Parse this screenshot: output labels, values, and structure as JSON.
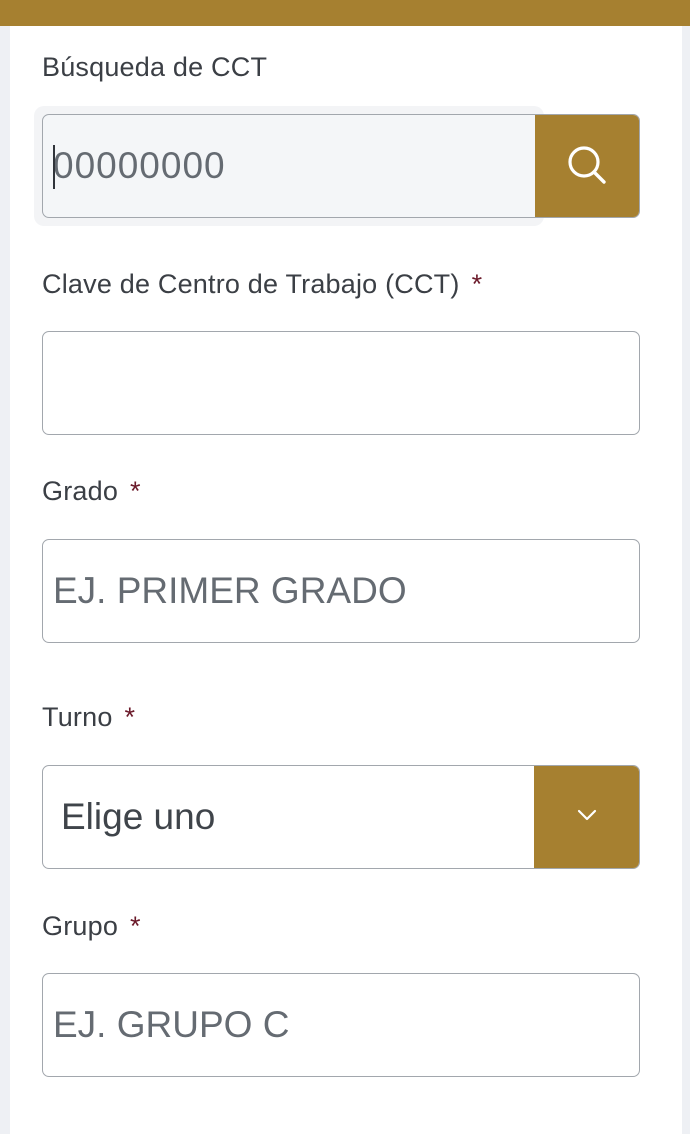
{
  "search": {
    "label": "Búsqueda de CCT",
    "placeholder": "00000000",
    "button_icon": "search-icon"
  },
  "fields": {
    "cct": {
      "label": "Clave de Centro de Trabajo (CCT)",
      "required_mark": "*",
      "placeholder": "",
      "value": ""
    },
    "grado": {
      "label": "Grado",
      "required_mark": "*",
      "placeholder": "EJ. PRIMER GRADO"
    },
    "turno": {
      "label": "Turno",
      "required_mark": "*",
      "selected": "Elige uno",
      "dropdown_icon": "chevron-down-icon"
    },
    "grupo": {
      "label": "Grupo",
      "required_mark": "*",
      "placeholder": "EJ. GRUPO C"
    }
  },
  "colors": {
    "accent": "#a68030",
    "required": "#6b1a2a",
    "text": "#3b3f45",
    "border": "#a2a7ad",
    "page_bg": "#eef0f4"
  }
}
